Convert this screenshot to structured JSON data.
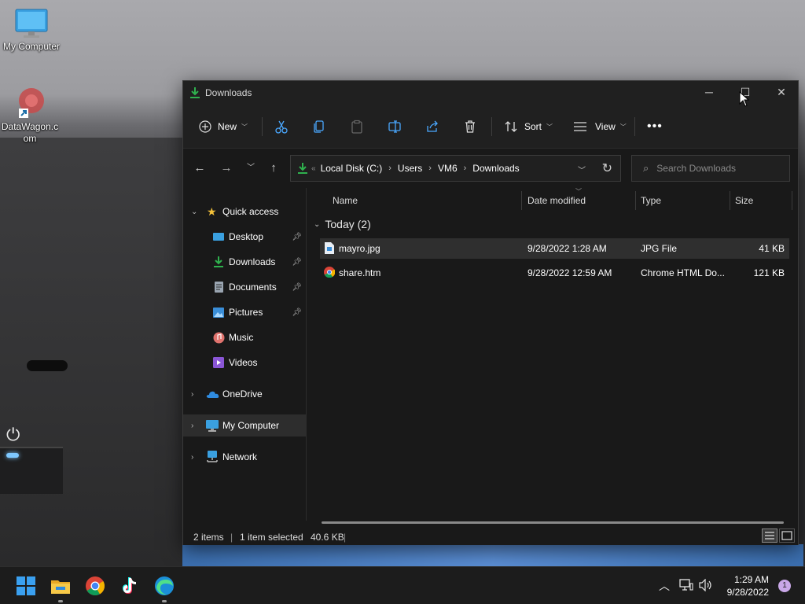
{
  "desktop": {
    "icons": [
      {
        "label": "My Computer"
      },
      {
        "label": "DataWagon.c om"
      }
    ]
  },
  "window": {
    "title": "Downloads",
    "toolbar": {
      "new_label": "New",
      "sort_label": "Sort",
      "view_label": "View"
    },
    "breadcrumb": [
      "Local Disk (C:)",
      "Users",
      "VM6",
      "Downloads"
    ],
    "search_placeholder": "Search Downloads",
    "nav": {
      "quick_access": "Quick access",
      "items": [
        {
          "label": "Desktop",
          "pinned": true
        },
        {
          "label": "Downloads",
          "pinned": true
        },
        {
          "label": "Documents",
          "pinned": true
        },
        {
          "label": "Pictures",
          "pinned": true
        },
        {
          "label": "Music",
          "pinned": false
        },
        {
          "label": "Videos",
          "pinned": false
        }
      ],
      "onedrive": "OneDrive",
      "my_computer": "My Computer",
      "network": "Network"
    },
    "columns": {
      "name": "Name",
      "date": "Date modified",
      "type": "Type",
      "size": "Size"
    },
    "group": "Today (2)",
    "files": [
      {
        "name": "mayro.jpg",
        "date": "9/28/2022 1:28 AM",
        "type": "JPG File",
        "size": "41 KB",
        "selected": true
      },
      {
        "name": "share.htm",
        "date": "9/28/2022 12:59 AM",
        "type": "Chrome HTML Do...",
        "size": "121 KB",
        "selected": false
      }
    ],
    "status": {
      "items": "2 items",
      "selected": "1 item selected",
      "selected_size": "40.6 KB"
    }
  },
  "taskbar": {
    "time": "1:29 AM",
    "date": "9/28/2022",
    "notification_count": "1"
  },
  "colors": {
    "accent_download": "#2fb14e",
    "folder_yellow": "#f3c13a",
    "window_bg": "#191919"
  }
}
